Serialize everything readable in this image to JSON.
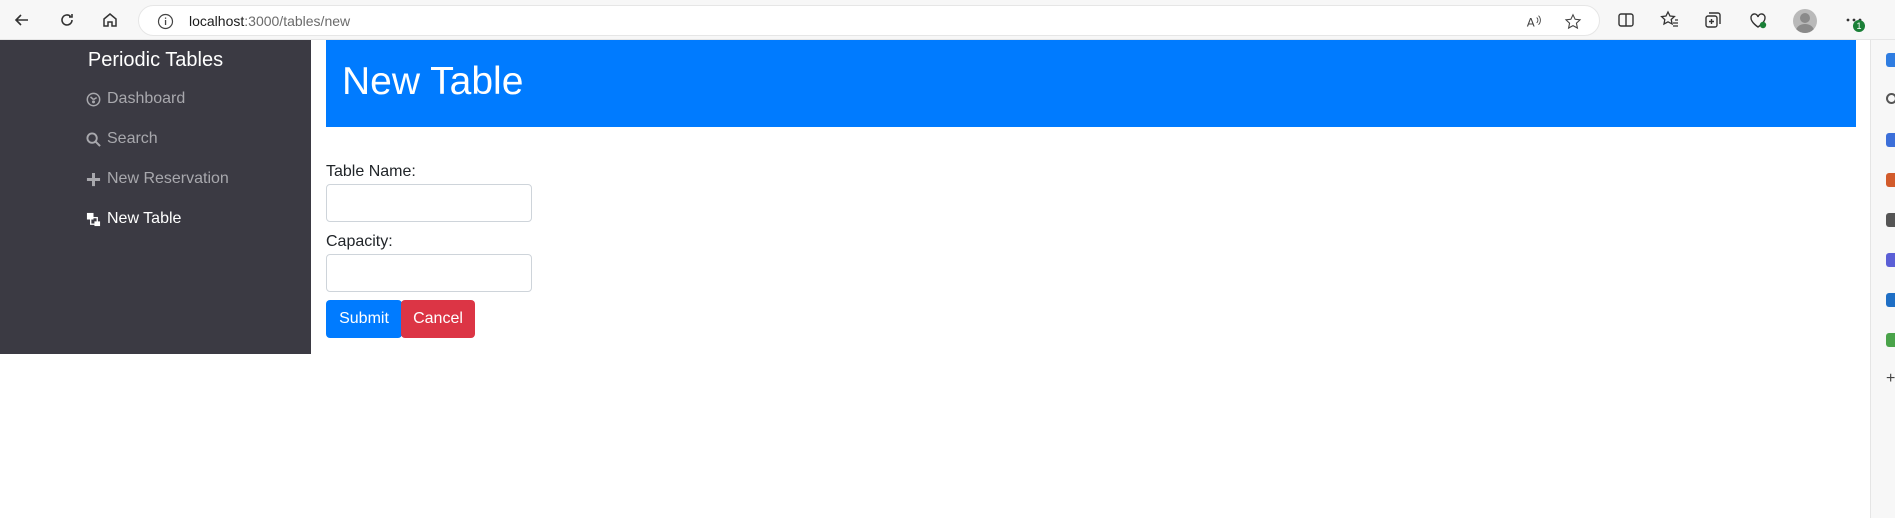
{
  "browser": {
    "url_host": "localhost",
    "url_path": ":3000/tables/new",
    "notification_badge": "1"
  },
  "sidebar": {
    "brand": "Periodic Tables",
    "items": [
      {
        "label": "Dashboard",
        "icon": "dashboard-icon",
        "active": false
      },
      {
        "label": "Search",
        "icon": "search-icon",
        "active": false
      },
      {
        "label": "New Reservation",
        "icon": "plus-icon",
        "active": false
      },
      {
        "label": "New Table",
        "icon": "table-icon",
        "active": true
      }
    ]
  },
  "header": {
    "title": "New Table"
  },
  "form": {
    "table_name_label": "Table Name:",
    "table_name_value": "",
    "capacity_label": "Capacity:",
    "capacity_value": "",
    "submit_label": "Submit",
    "cancel_label": "Cancel"
  },
  "colors": {
    "primary": "#007bff",
    "danger": "#dc3545",
    "sidebar_bg": "#3b3a43"
  }
}
